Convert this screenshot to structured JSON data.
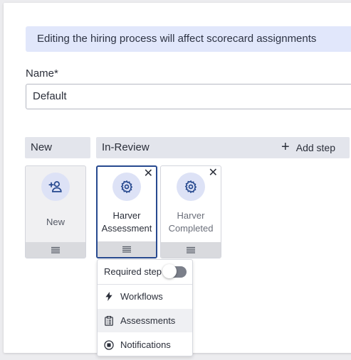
{
  "banner": {
    "text": "Editing the hiring process will affect scorecard assignments"
  },
  "name_field": {
    "label": "Name*",
    "value": "Default"
  },
  "columns": [
    {
      "title": "New"
    },
    {
      "title": "In-Review",
      "add_step_label": "Add step"
    }
  ],
  "cards": [
    {
      "title": "New",
      "icon": "add-person-icon",
      "selected": false
    },
    {
      "title": "Harver Assessment",
      "line1": "Harver",
      "line2": "Assessment",
      "icon": "gear-icon",
      "selected": true,
      "closable": true
    },
    {
      "title": "Harver Completed",
      "line1": "Harver",
      "line2": "Completed",
      "icon": "gear-icon",
      "selected": false,
      "closable": true
    }
  ],
  "step_menu": {
    "required_label": "Required step",
    "required_on": false,
    "items": [
      {
        "label": "Workflows",
        "icon": "lightning-icon"
      },
      {
        "label": "Assessments",
        "icon": "clipboard-icon",
        "highlighted": true
      },
      {
        "label": "Notifications",
        "icon": "bell-circle-icon"
      }
    ]
  },
  "colors": {
    "accent": "#27498f",
    "banner_bg": "#e1e7fb",
    "icon_bg": "#dde2f6"
  }
}
